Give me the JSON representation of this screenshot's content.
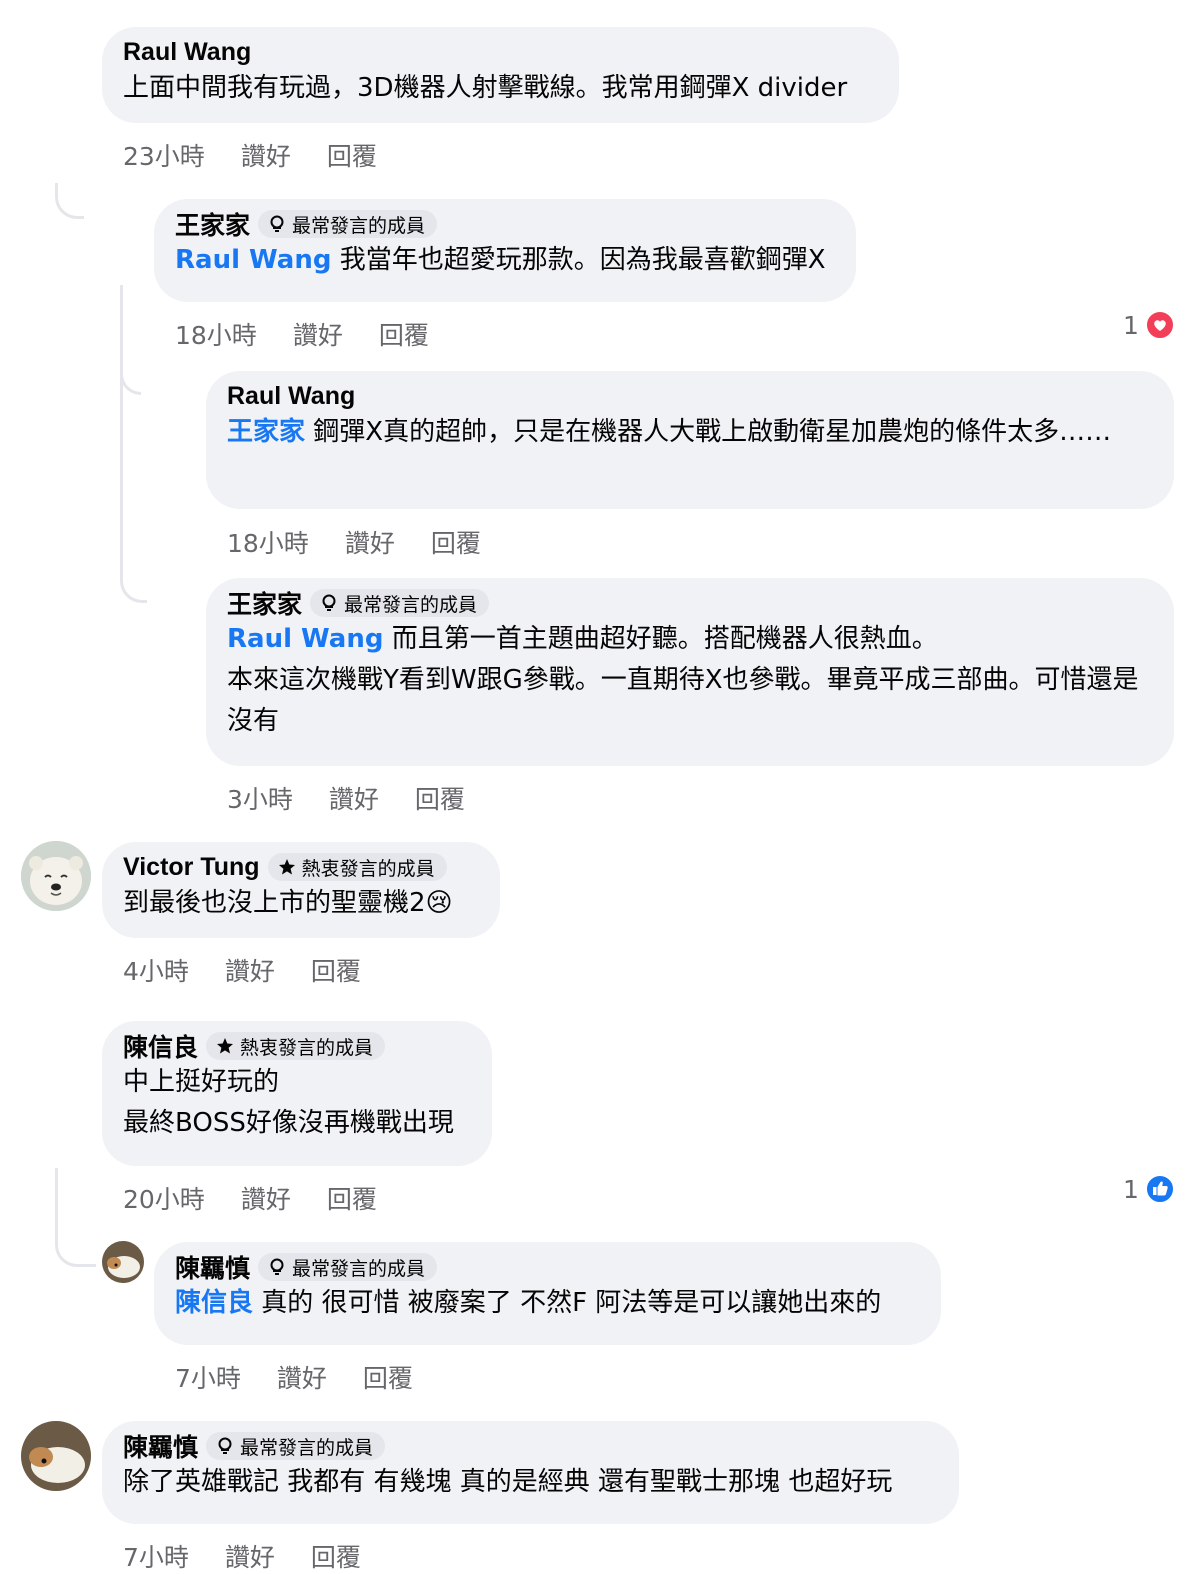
{
  "actions": {
    "like_label": "讚好",
    "reply_label": "回覆"
  },
  "badges": {
    "frequent": "最常發言的成員",
    "active": "熱衷發言的成員"
  },
  "comments": [
    {
      "author": "Raul Wang",
      "text": "上面中間我有玩過，3D機器人射擊戰線。我常用鋼彈X divider",
      "time": "23小時"
    },
    {
      "author": "王家家",
      "badge": "最常發言的成員",
      "mention": "Raul Wang",
      "text": " 我當年也超愛玩那款。因為我最喜歡鋼彈X",
      "time": "18小時",
      "reaction_count": "1",
      "reaction_icon": "heart-reaction-icon"
    },
    {
      "author": "Raul Wang",
      "mention": "王家家",
      "text": " 鋼彈X真的超帥，只是在機器人大戰上啟動衛星加農炮的條件太多……",
      "time": "18小時"
    },
    {
      "author": "王家家",
      "badge": "最常發言的成員",
      "mention": "Raul Wang",
      "text": " 而且第一首主題曲超好聽。搭配機器人很熱血。\n本來這次機戰Y看到W跟G參戰。一直期待X也參戰。畢竟平成三部曲。可惜還是沒有",
      "time": "3小時"
    },
    {
      "author": "Victor Tung",
      "badge": "熱衷發言的成員",
      "text": "到最後也沒上市的聖靈機2",
      "emoji": "😢",
      "time": "4小時"
    },
    {
      "author": "陳信良",
      "badge": "熱衷發言的成員",
      "text": "中上挺好玩的\n最終BOSS好像沒再機戰出現",
      "time": "20小時",
      "reaction_count": "1",
      "reaction_icon": "like-reaction-icon"
    },
    {
      "author": "陳羈慎",
      "badge": "最常發言的成員",
      "mention": "陳信良",
      "text": " 真的 很可惜 被廢案了 不然F 阿法等是可以讓她出來的",
      "time": "7小時"
    },
    {
      "author": "陳羈慎",
      "badge": "最常發言的成員",
      "text": "除了英雄戰記 我都有 有幾塊 真的是經典 還有聖戰士那塊 也超好玩",
      "time": "7小時"
    }
  ],
  "colors": {
    "mention": "#1877f2",
    "bubble": "#f0f2f5",
    "meta": "#65676b",
    "heart": "#f33e58",
    "like": "#1877f2"
  }
}
